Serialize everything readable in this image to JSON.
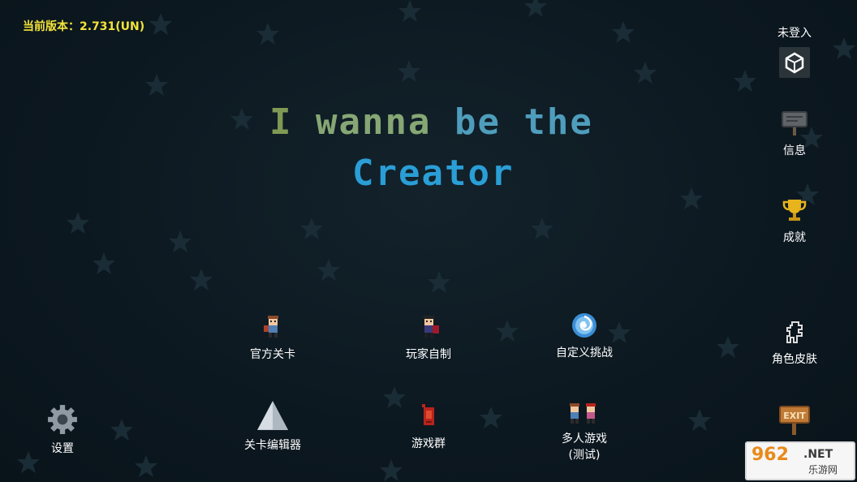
{
  "version_text": "当前版本：2.731(UN)",
  "title": {
    "word1": "I",
    "word2": "wanna",
    "word3": "be the",
    "word4": "Creator"
  },
  "login": {
    "status": "未登入",
    "icon": "unity-logo-icon"
  },
  "side_menu": {
    "info": {
      "label": "信息",
      "icon": "signboard-icon"
    },
    "achievements": {
      "label": "成就",
      "icon": "trophy-icon"
    },
    "skins": {
      "label": "角色皮肤",
      "icon": "character-outline-icon"
    },
    "exit": {
      "label": "EXIT",
      "icon": "exit-sign-icon"
    }
  },
  "main_menu": {
    "official_levels": {
      "label": "官方关卡",
      "icon": "kid-character-icon"
    },
    "player_made": {
      "label": "玩家自制",
      "icon": "caped-character-icon"
    },
    "custom_challenge": {
      "label": "自定义挑战",
      "icon": "swirl-portal-icon"
    },
    "level_editor": {
      "label": "关卡编辑器",
      "icon": "triangle-icon"
    },
    "game_group": {
      "label": "游戏群",
      "icon": "red-device-icon"
    },
    "multiplayer": {
      "label": "多人游戏",
      "label2": "(测试)",
      "icon": "two-characters-icon"
    },
    "settings": {
      "label": "设置",
      "icon": "gear-icon"
    }
  },
  "watermark": {
    "top": "962",
    "net": ".NET",
    "bottom": "乐游网"
  },
  "colors": {
    "background": "#0c1820",
    "version": "#f3e33a",
    "title_green": "#86a774",
    "title_blue": "#2a9ed6",
    "star": "#1c2f38"
  }
}
